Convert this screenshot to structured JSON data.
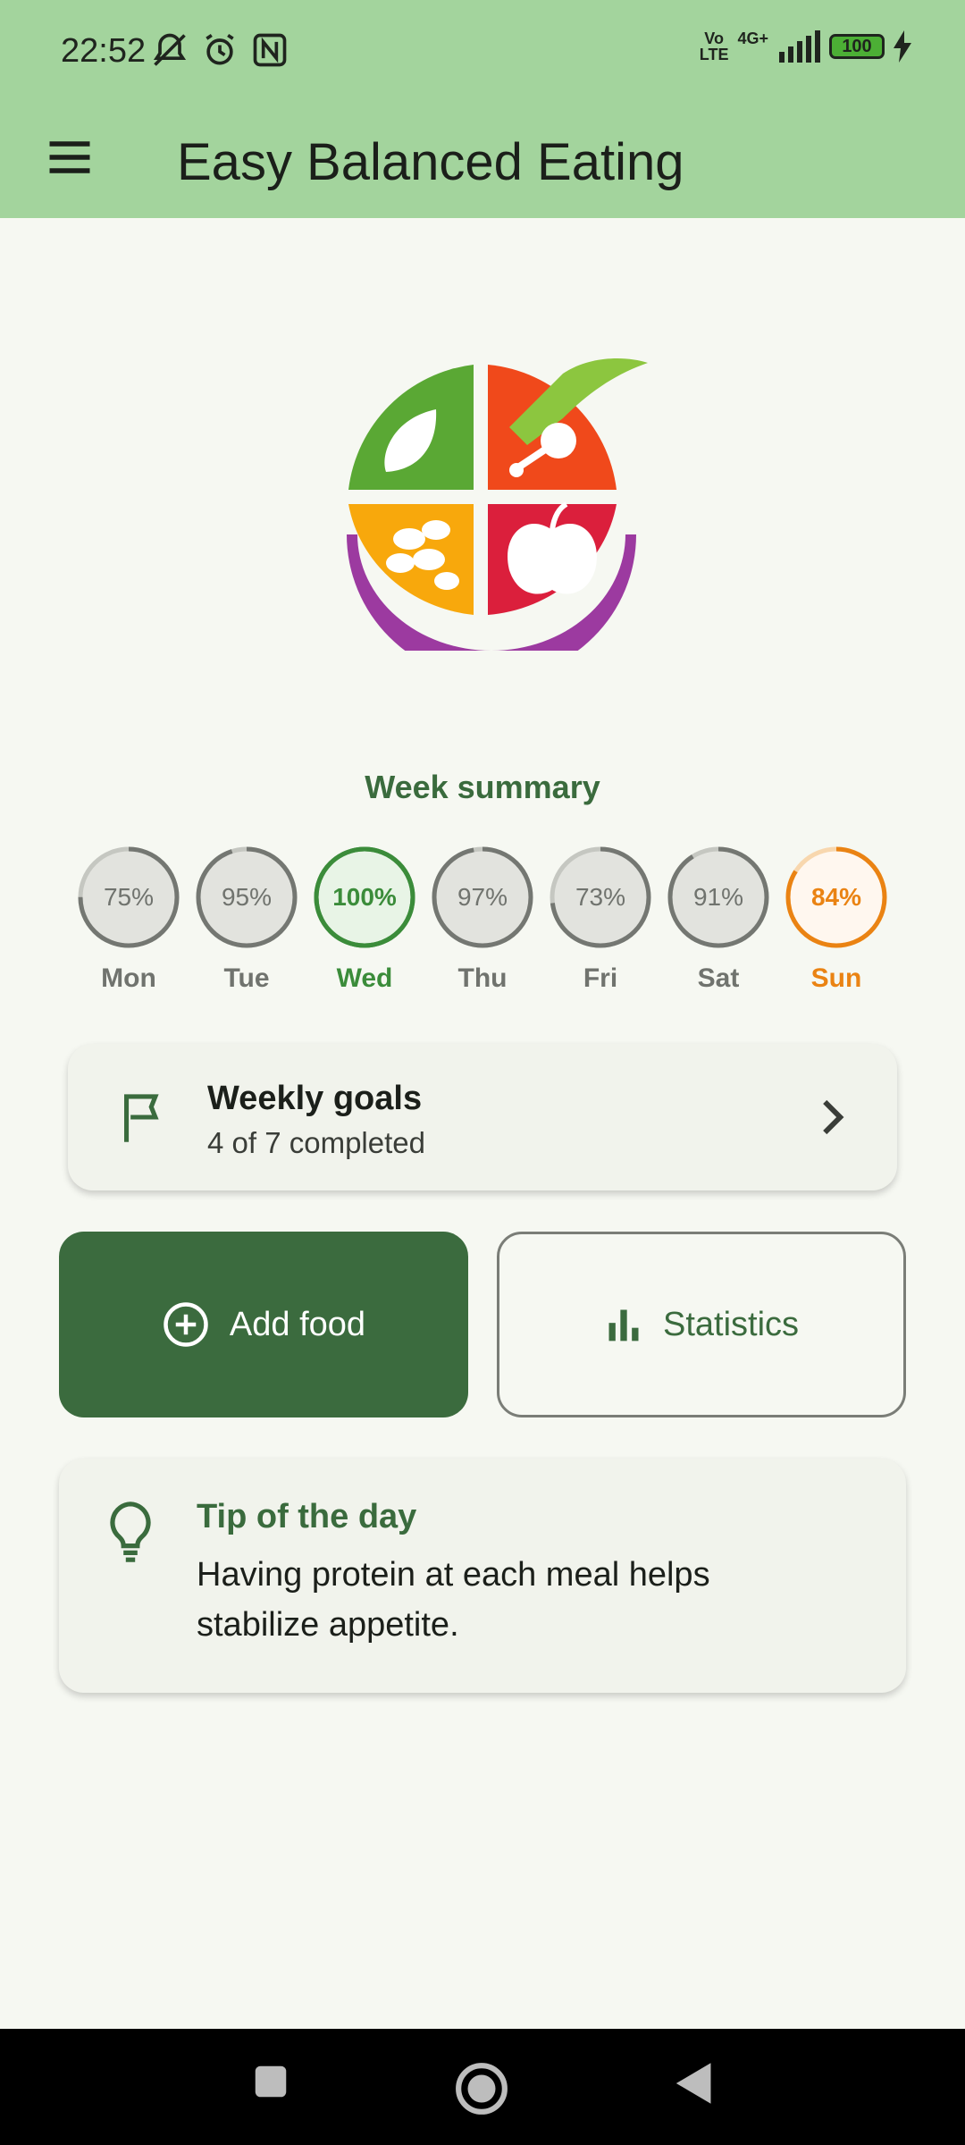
{
  "status_bar": {
    "time": "22:52",
    "network": "4G+",
    "volte_top": "Vo",
    "volte_bottom": "LTE",
    "battery": "100"
  },
  "app_bar": {
    "title": "Easy Balanced Eating",
    "menu_icon": "menu-icon"
  },
  "week_summary": {
    "title": "Week summary",
    "days": [
      {
        "label": "Mon",
        "percent": "75%",
        "value": 0.75,
        "state": "normal"
      },
      {
        "label": "Tue",
        "percent": "95%",
        "value": 0.95,
        "state": "normal"
      },
      {
        "label": "Wed",
        "percent": "100%",
        "value": 1.0,
        "state": "active"
      },
      {
        "label": "Thu",
        "percent": "97%",
        "value": 0.97,
        "state": "normal"
      },
      {
        "label": "Fri",
        "percent": "73%",
        "value": 0.73,
        "state": "normal"
      },
      {
        "label": "Sat",
        "percent": "91%",
        "value": 0.91,
        "state": "normal"
      },
      {
        "label": "Sun",
        "percent": "84%",
        "value": 0.84,
        "state": "current"
      }
    ]
  },
  "goals": {
    "title": "Weekly goals",
    "subtitle": "4 of 7 completed",
    "icon": "flag-icon"
  },
  "actions": {
    "add_food": "Add food",
    "statistics": "Statistics"
  },
  "tip": {
    "title": "Tip of the day",
    "text": "Having protein at each meal helps stabilize appetite.",
    "icon": "lightbulb-icon"
  },
  "colors": {
    "app_bar": "#a3d49d",
    "primary": "#3b6b3e",
    "active_day": "#3b8c3a",
    "current_day": "#ea8313",
    "background": "#f6f8f2"
  }
}
